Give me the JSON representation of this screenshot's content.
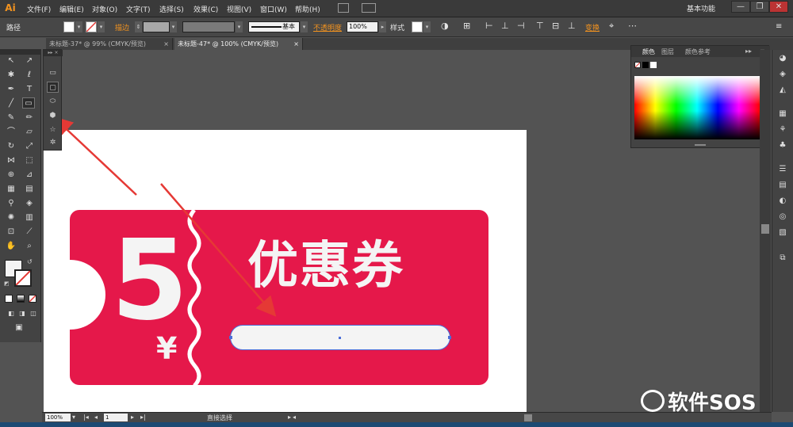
{
  "app": {
    "logo": "Ai"
  },
  "menu": {
    "items": [
      "文件(F)",
      "编辑(E)",
      "对象(O)",
      "文字(T)",
      "选择(S)",
      "效果(C)",
      "视图(V)",
      "窗口(W)",
      "帮助(H)"
    ],
    "workspace": "基本功能"
  },
  "window": {
    "minimize": "—",
    "restore": "❐",
    "close": "✕"
  },
  "control": {
    "object_type": "路径",
    "stroke_label": "描边",
    "stroke_style": "基本",
    "opacity_label": "不透明度",
    "opacity_value": "100%",
    "style_label": "样式",
    "transform_label": "变换"
  },
  "tabs": [
    {
      "label": "未标题-37* @ 99% (CMYK/预览)",
      "close": "×"
    },
    {
      "label": "未标题-47* @ 100% (CMYK/预览)",
      "close": "×"
    }
  ],
  "color_panel": {
    "tabs": [
      "颜色",
      "图层",
      "颜色参考"
    ]
  },
  "coupon": {
    "amount": "5",
    "currency": "¥",
    "title": "优惠券",
    "bg_color": "#e5184a"
  },
  "status": {
    "zoom": "100%",
    "page": "1",
    "tool": "直接选择"
  },
  "watermark": {
    "text": "软件SOS"
  },
  "colors": {
    "accent": "#f3931f",
    "arrow": "#e53935",
    "selection": "#4a6ed8"
  }
}
